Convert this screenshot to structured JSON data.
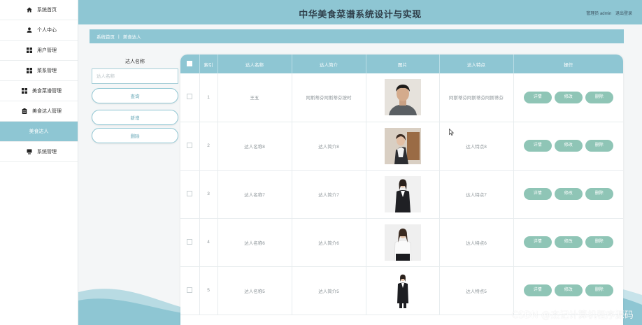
{
  "app": {
    "title": "中华美食菜谱系统设计与实现",
    "user_role_label": "管理员 admin",
    "logout_label": "退出登录"
  },
  "sidebar": {
    "items": [
      {
        "label": "系统首页",
        "icon": "home-icon"
      },
      {
        "label": "个人中心",
        "icon": "user-icon"
      },
      {
        "label": "用户管理",
        "icon": "grid-icon"
      },
      {
        "label": "菜系管理",
        "icon": "grid-icon"
      },
      {
        "label": "美食菜谱管理",
        "icon": "grid-icon"
      },
      {
        "label": "美食达人管理",
        "icon": "clipboard-icon"
      },
      {
        "label": "美食达人",
        "icon": "",
        "active": true
      },
      {
        "label": "系统管理",
        "icon": "monitor-icon"
      }
    ]
  },
  "breadcrumb": {
    "home": "系统首页",
    "separator": "|",
    "current": "美食达人"
  },
  "search": {
    "label": "达人名称",
    "placeholder": "达人名称",
    "query_button": "查询",
    "add_button": "新增",
    "delete_button": "删除"
  },
  "table": {
    "headers": [
      "索引",
      "达人名称",
      "达人简介",
      "图片",
      "达人特点",
      "操作"
    ],
    "action_labels": {
      "detail": "详情",
      "edit": "修改",
      "delete": "删除"
    },
    "rows": [
      {
        "index": "1",
        "name": "王五",
        "intro": "阿斯蒂芬阿斯蒂芬按时",
        "feature": "阿斯蒂芬阿斯蒂芬阿斯蒂芬",
        "photo": "man-casual-photo"
      },
      {
        "index": "2",
        "name": "达人名称8",
        "intro": "达人简介8",
        "feature": "达人特点8",
        "photo": "woman-office-photo"
      },
      {
        "index": "3",
        "name": "达人名称7",
        "intro": "达人简介7",
        "feature": "达人特点7",
        "photo": "woman-suit-photo"
      },
      {
        "index": "4",
        "name": "达人名称6",
        "intro": "达人简介6",
        "feature": "达人特点6",
        "photo": "woman-blouse-photo"
      },
      {
        "index": "5",
        "name": "达人名称5",
        "intro": "达人简介5",
        "feature": "达人特点5",
        "photo": "woman-suit-standing-photo"
      }
    ]
  },
  "watermark": "CSDN @杰记计算机程序源码",
  "colors": {
    "accent": "#8ec6d3",
    "action_button": "#8fc5b6",
    "background": "#f4f6f7"
  }
}
